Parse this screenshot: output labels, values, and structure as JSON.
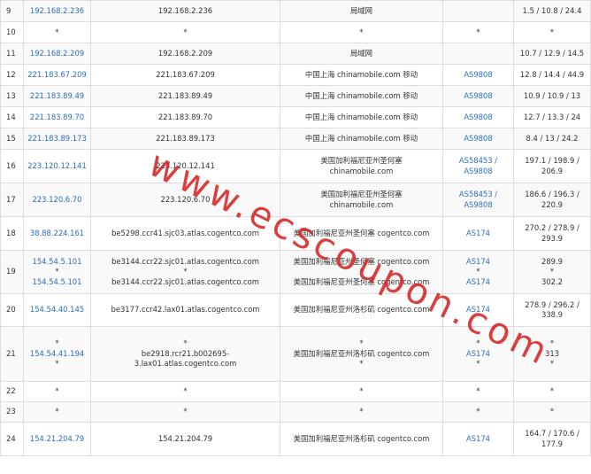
{
  "watermark": "www.ecscoupon.com",
  "colors": {
    "link": "#2a6ebb",
    "watermark": "#d42424",
    "border": "#dddddd",
    "row_stripe": "#f9f9f9"
  },
  "rows": [
    {
      "hop": "9",
      "ip": [
        "192.168.2.236"
      ],
      "host": [
        "192.168.2.236"
      ],
      "loc": [
        "局域网"
      ],
      "asn": [
        ""
      ],
      "time": [
        "1.5 / 10.8 / 24.4"
      ]
    },
    {
      "hop": "10",
      "ip": [
        "*"
      ],
      "host": [
        "*"
      ],
      "loc": [
        "*"
      ],
      "asn": [
        "*"
      ],
      "time": [
        "*"
      ]
    },
    {
      "hop": "11",
      "ip": [
        "192.168.2.209"
      ],
      "host": [
        "192.168.2.209"
      ],
      "loc": [
        "局域网"
      ],
      "asn": [
        ""
      ],
      "time": [
        "10.7 / 12.9 / 14.5"
      ]
    },
    {
      "hop": "12",
      "ip": [
        "221.183.67.209"
      ],
      "host": [
        "221.183.67.209"
      ],
      "loc": [
        "中国上海 chinamobile.com 移动"
      ],
      "asn": [
        "AS9808"
      ],
      "time": [
        "12.8 / 14.4 / 44.9"
      ]
    },
    {
      "hop": "13",
      "ip": [
        "221.183.89.49"
      ],
      "host": [
        "221.183.89.49"
      ],
      "loc": [
        "中国上海 chinamobile.com 移动"
      ],
      "asn": [
        "AS9808"
      ],
      "time": [
        "10.9 / 10.9 / 13"
      ]
    },
    {
      "hop": "14",
      "ip": [
        "221.183.89.70"
      ],
      "host": [
        "221.183.89.70"
      ],
      "loc": [
        "中国上海 chinamobile.com 移动"
      ],
      "asn": [
        "AS9808"
      ],
      "time": [
        "12.7 / 13.3 / 24"
      ]
    },
    {
      "hop": "15",
      "ip": [
        "221.183.89.173"
      ],
      "host": [
        "221.183.89.173"
      ],
      "loc": [
        "中国上海 chinamobile.com 移动"
      ],
      "asn": [
        "AS9808"
      ],
      "time": [
        "8.4 / 13 / 24.2"
      ]
    },
    {
      "hop": "16",
      "ip": [
        "223.120.12.141"
      ],
      "host": [
        "223.120.12.141"
      ],
      "loc": [
        "美国加利福尼亚州圣何塞",
        "chinamobile.com"
      ],
      "asn": [
        "AS58453 /",
        "AS9808"
      ],
      "time": [
        "197.1 / 198.9 /",
        "206.9"
      ]
    },
    {
      "hop": "17",
      "ip": [
        "223.120.6.70"
      ],
      "host": [
        "223.120.6.70"
      ],
      "loc": [
        "美国加利福尼亚州圣何塞",
        "chinamobile.com"
      ],
      "asn": [
        "AS58453 /",
        "AS9808"
      ],
      "time": [
        "186.6 / 196.3 /",
        "220.9"
      ]
    },
    {
      "hop": "18",
      "ip": [
        "38.88.224.161"
      ],
      "host": [
        "be5298.ccr41.sjc03.atlas.cogentco.com"
      ],
      "loc": [
        "美国加利福尼亚州圣何塞 cogentco.com"
      ],
      "asn": [
        "AS174"
      ],
      "time": [
        "270.2 / 278.9 /",
        "293.9"
      ]
    },
    {
      "hop": "19",
      "ip": [
        "154.54.5.101",
        "*",
        "154.54.5.101"
      ],
      "host": [
        "be3144.ccr22.sjc01.atlas.cogentco.com",
        "*",
        "be3144.ccr22.sjc01.atlas.cogentco.com"
      ],
      "loc": [
        "美国加利福尼亚州圣何塞 cogentco.com",
        "*",
        "美国加利福尼亚州圣何塞 cogentco.com"
      ],
      "asn": [
        "AS174",
        "*",
        "AS174"
      ],
      "time": [
        "289.9",
        "*",
        "302.2"
      ]
    },
    {
      "hop": "20",
      "ip": [
        "154.54.40.145"
      ],
      "host": [
        "be3177.ccr42.lax01.atlas.cogentco.com"
      ],
      "loc": [
        "美国加利福尼亚州洛杉矶 cogentco.com"
      ],
      "asn": [
        "AS174"
      ],
      "time": [
        "278.9 / 296.2 /",
        "338.9"
      ]
    },
    {
      "hop": "21",
      "ip": [
        "*",
        "154.54.41.194",
        "*"
      ],
      "host": [
        "*",
        "be2918.rcr21.b002695-",
        "3.lax01.atlas.cogentco.com"
      ],
      "loc": [
        "*",
        "美国加利福尼亚州洛杉矶 cogentco.com",
        "*"
      ],
      "asn": [
        "*",
        "AS174",
        "*"
      ],
      "time": [
        "*",
        "313",
        "*"
      ]
    },
    {
      "hop": "22",
      "ip": [
        "*"
      ],
      "host": [
        "*"
      ],
      "loc": [
        "*"
      ],
      "asn": [
        "*"
      ],
      "time": [
        "*"
      ]
    },
    {
      "hop": "23",
      "ip": [
        "*"
      ],
      "host": [
        "*"
      ],
      "loc": [
        "*"
      ],
      "asn": [
        "*"
      ],
      "time": [
        "*"
      ]
    },
    {
      "hop": "24",
      "ip": [
        "154.21.204.79"
      ],
      "host": [
        "154.21.204.79"
      ],
      "loc": [
        "美国加利福尼亚州洛杉矶 cogentco.com"
      ],
      "asn": [
        "AS174"
      ],
      "time": [
        "164.7 / 170.6 /",
        "177.9"
      ]
    }
  ]
}
